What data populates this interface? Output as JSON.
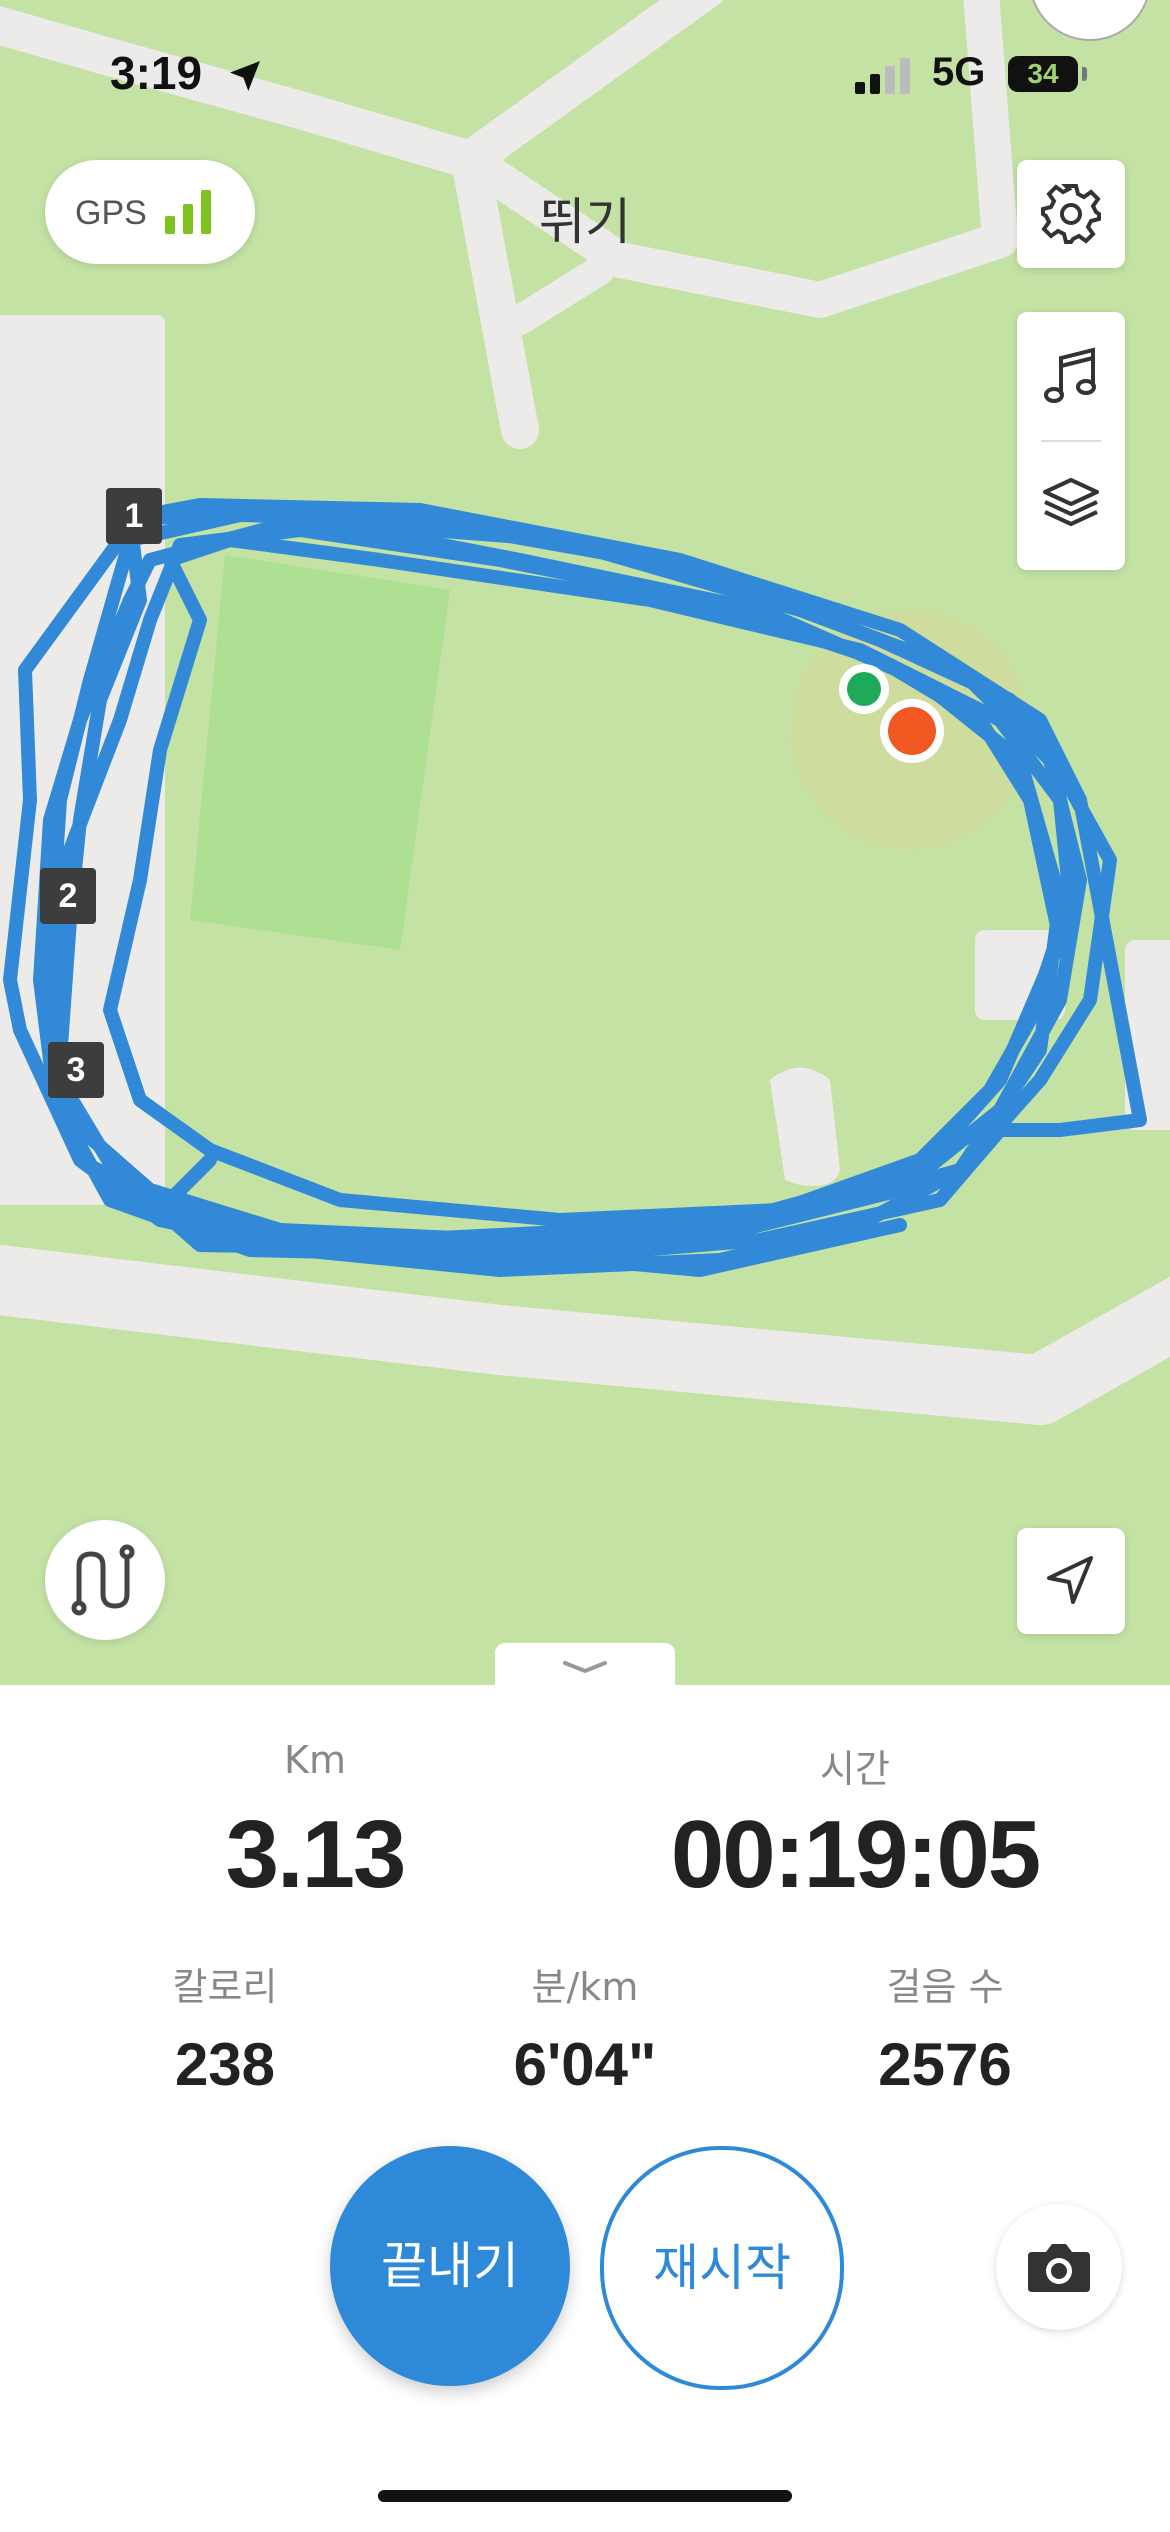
{
  "status_bar": {
    "time": "3:19",
    "network": "5G",
    "battery": "34"
  },
  "gps": {
    "label": "GPS"
  },
  "header": {
    "title": "뛰기"
  },
  "map": {
    "route_color": "#3189d8",
    "start_color": "#1faa5a",
    "end_color": "#f05a22",
    "markers": [
      "1",
      "2",
      "3"
    ]
  },
  "stats": {
    "distance": {
      "label": "Km",
      "value": "3.13"
    },
    "time": {
      "label": "시간",
      "value": "00:19:05"
    },
    "calories": {
      "label": "칼로리",
      "value": "238"
    },
    "pace": {
      "label": "분/km",
      "value": "6'04\""
    },
    "steps": {
      "label": "걸음 수",
      "value": "2576"
    }
  },
  "actions": {
    "finish": "끝내기",
    "resume": "재시작"
  }
}
